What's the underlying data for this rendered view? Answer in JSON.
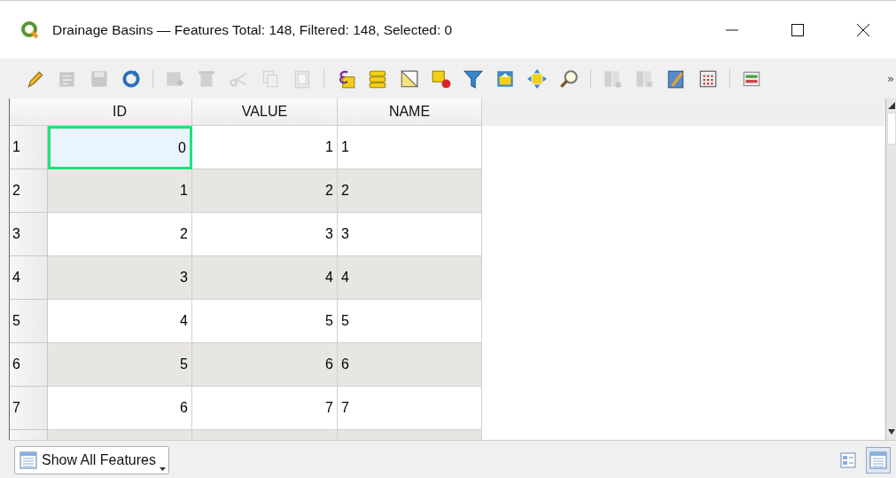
{
  "window": {
    "title": "Drainage Basins — Features Total: 148, Filtered: 148, Selected: 0"
  },
  "toolbar": [
    [
      {
        "disabled": false
      },
      {
        "disabled": true
      },
      {
        "disabled": true
      },
      {
        "disabled": false
      }
    ],
    [
      {
        "disabled": true
      },
      {
        "disabled": true
      },
      {
        "disabled": true
      },
      {
        "disabled": true
      },
      {
        "disabled": true
      }
    ],
    [
      {
        "disabled": false
      },
      {
        "disabled": false
      },
      {
        "disabled": false
      },
      {
        "disabled": false
      },
      {
        "disabled": false
      },
      {
        "disabled": false
      },
      {
        "disabled": false
      },
      {
        "disabled": false
      }
    ],
    [
      {
        "disabled": true
      },
      {
        "disabled": true
      },
      {
        "disabled": false
      },
      {
        "disabled": false
      }
    ],
    [
      {
        "disabled": false
      }
    ]
  ],
  "toolbar_overflow": "»",
  "table": {
    "columns": [
      "ID",
      "VALUE",
      "NAME"
    ],
    "rows": [
      {
        "header": "1",
        "cells": [
          {
            "text": "0",
            "focused": true
          },
          {
            "text": "1",
            "focused": false
          },
          {
            "text": "1",
            "focused": false
          }
        ]
      },
      {
        "header": "2",
        "cells": [
          {
            "text": "1",
            "focused": false
          },
          {
            "text": "2",
            "focused": false
          },
          {
            "text": "2",
            "focused": false
          }
        ]
      },
      {
        "header": "3",
        "cells": [
          {
            "text": "2",
            "focused": false
          },
          {
            "text": "3",
            "focused": false
          },
          {
            "text": "3",
            "focused": false
          }
        ]
      },
      {
        "header": "4",
        "cells": [
          {
            "text": "3",
            "focused": false
          },
          {
            "text": "4",
            "focused": false
          },
          {
            "text": "4",
            "focused": false
          }
        ]
      },
      {
        "header": "5",
        "cells": [
          {
            "text": "4",
            "focused": false
          },
          {
            "text": "5",
            "focused": false
          },
          {
            "text": "5",
            "focused": false
          }
        ]
      },
      {
        "header": "6",
        "cells": [
          {
            "text": "5",
            "focused": false
          },
          {
            "text": "6",
            "focused": false
          },
          {
            "text": "6",
            "focused": false
          }
        ]
      },
      {
        "header": "7",
        "cells": [
          {
            "text": "6",
            "focused": false
          },
          {
            "text": "7",
            "focused": false
          },
          {
            "text": "7",
            "focused": false
          }
        ]
      }
    ]
  },
  "filter_button": {
    "label": "Show All Features"
  },
  "view_buttons": [
    {
      "selected": false
    },
    {
      "selected": true
    }
  ]
}
